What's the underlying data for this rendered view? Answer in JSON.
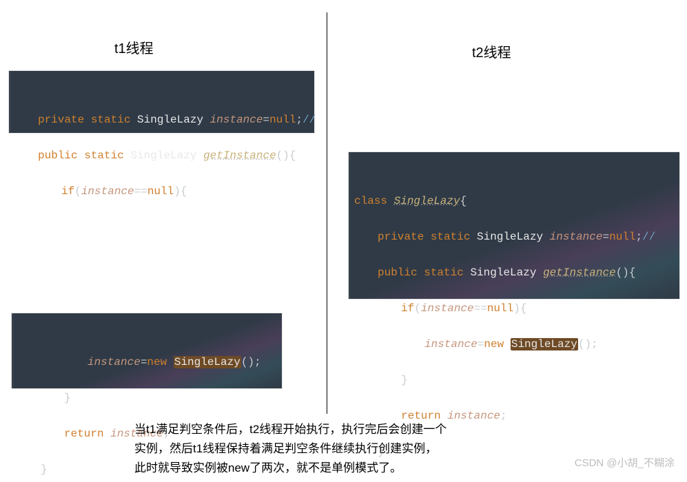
{
  "headings": {
    "left": "t1线程",
    "right": "t2线程"
  },
  "tokens": {
    "class": "class",
    "private": "private",
    "public": "public",
    "static": "static",
    "type": "SingleLazy",
    "instance": "instance",
    "getInstance": "getInstance",
    "null": "null",
    "new": "new",
    "if": "if",
    "return": "return",
    "eq": "=",
    "eqeq": "==",
    "lparen": "(",
    "rparen": ")",
    "parens": "()",
    "lbrace": "{",
    "rbrace": "}",
    "semi": ";",
    "comment": "//"
  },
  "code_t1_top": [
    "private static SingleLazy instance=null;//",
    "public static SingleLazy getInstance(){",
    "    if(instance==null){"
  ],
  "code_t1_bottom": [
    "        instance=new SingleLazy();",
    "    }",
    "    return instance;",
    "}"
  ],
  "code_t2": [
    "class SingleLazy{",
    "    private static SingleLazy instance=null;//",
    "    public static SingleLazy getInstance(){",
    "        if(instance==null){",
    "            instance=new SingleLazy();",
    "        }",
    "        return instance;",
    "    }"
  ],
  "explanation": {
    "line1": "当t1满足判空条件后，t2线程开始执行，执行完后会创建一个",
    "line2": "实例，然后t1线程保持着满足判空条件继续执行创建实例，",
    "line3": "此时就导致实例被new了两次，就不是单例模式了。"
  },
  "watermark": "CSDN @小胡_不糊涂"
}
